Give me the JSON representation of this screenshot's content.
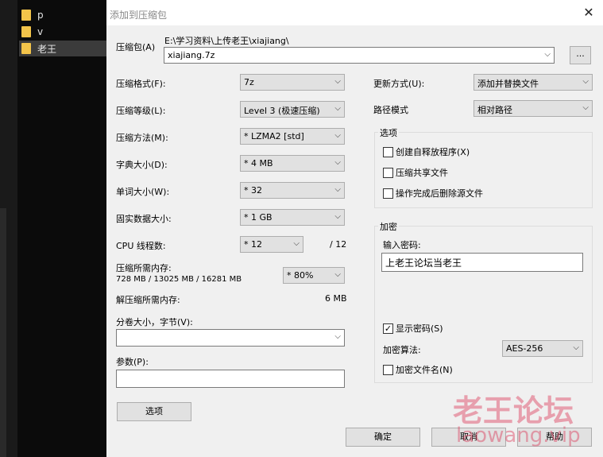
{
  "explorer": {
    "items": [
      {
        "label": "p"
      },
      {
        "label": "v"
      },
      {
        "label": "老王"
      }
    ]
  },
  "dialog": {
    "title": "添加到压缩包",
    "archive": {
      "label": "压缩包(A)",
      "path": "E:\\学习资料\\上传老王\\xiajiang\\",
      "name": "xiajiang.7z",
      "browse_label": "..."
    },
    "left": {
      "format": {
        "label": "压缩格式(F):",
        "value": "7z"
      },
      "level": {
        "label": "压缩等级(L):",
        "value": "Level 3 (极速压缩)"
      },
      "method": {
        "label": "压缩方法(M):",
        "value": "* LZMA2 [std]"
      },
      "dict": {
        "label": "字典大小(D):",
        "value": "* 4 MB"
      },
      "word": {
        "label": "单词大小(W):",
        "value": "* 32"
      },
      "solid": {
        "label": "固实数据大小:",
        "value": "* 1 GB"
      },
      "threads": {
        "label": "CPU 线程数:",
        "value": "* 12",
        "max": "/ 12"
      },
      "mem_compress": {
        "label": "压缩所需内存:",
        "detail": "728 MB / 13025 MB / 16281 MB",
        "value": "* 80%"
      },
      "mem_decompress": {
        "label": "解压缩所需内存:",
        "value": "6 MB"
      },
      "split": {
        "label": "分卷大小，字节(V):",
        "value": ""
      },
      "params": {
        "label": "参数(P):",
        "value": ""
      },
      "options_button": "选项"
    },
    "right": {
      "update_mode": {
        "label": "更新方式(U):",
        "value": "添加并替换文件"
      },
      "path_mode": {
        "label": "路径模式",
        "value": "相对路径"
      },
      "options": {
        "title": "选项",
        "sfx": "创建自释放程序(X)",
        "shared": "压缩共享文件",
        "delete": "操作完成后删除源文件"
      },
      "encryption": {
        "title": "加密",
        "password_label": "输入密码:",
        "password": "上老王论坛当老王",
        "show_password": "显示密码(S)",
        "method_label": "加密算法:",
        "method": "AES-256",
        "encrypt_names": "加密文件名(N)"
      }
    },
    "buttons": {
      "ok": "确定",
      "cancel": "取消",
      "help": "帮助"
    }
  },
  "watermark": {
    "text": "老王论坛",
    "url": "laowang.vip"
  },
  "colors": {
    "dialog_bg": "#f0f0f0",
    "watermark": "#dc3c5a"
  }
}
